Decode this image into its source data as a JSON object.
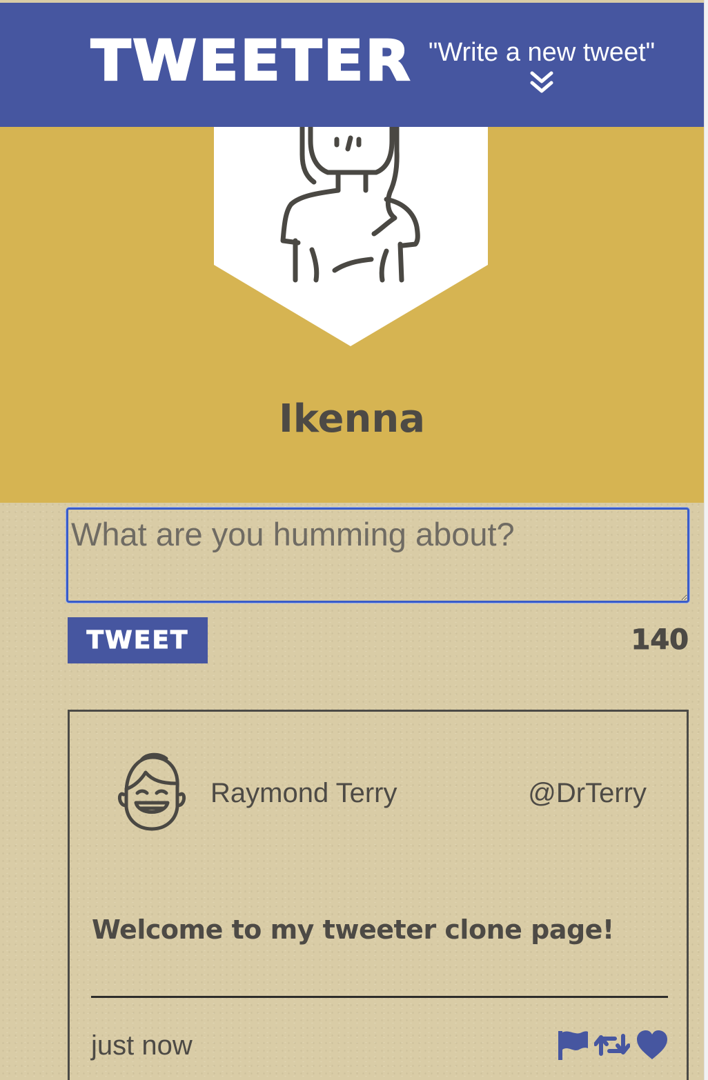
{
  "nav": {
    "brand": "TWEETER",
    "compose_toggle_label": "\"Write a new tweet\"",
    "compose_toggle_icon": "double-chevron-down-icon",
    "background_color": "#4656a0"
  },
  "profile": {
    "name": "Ikenna",
    "avatar_icon": "woman-avatar-icon",
    "background_color": "#d6b452"
  },
  "composer": {
    "placeholder": "What are you humming about?",
    "value": "",
    "submit_label": "TWEET",
    "char_counter": "140",
    "accent_color": "#4656a0"
  },
  "tweets": [
    {
      "author_name": "Raymond Terry",
      "handle": "@DrTerry",
      "avatar_icon": "smiling-man-avatar-icon",
      "content": "Welcome to my tweeter clone page!",
      "timestamp": "just now",
      "actions": [
        "flag-icon",
        "retweet-icon",
        "heart-icon"
      ]
    }
  ]
}
